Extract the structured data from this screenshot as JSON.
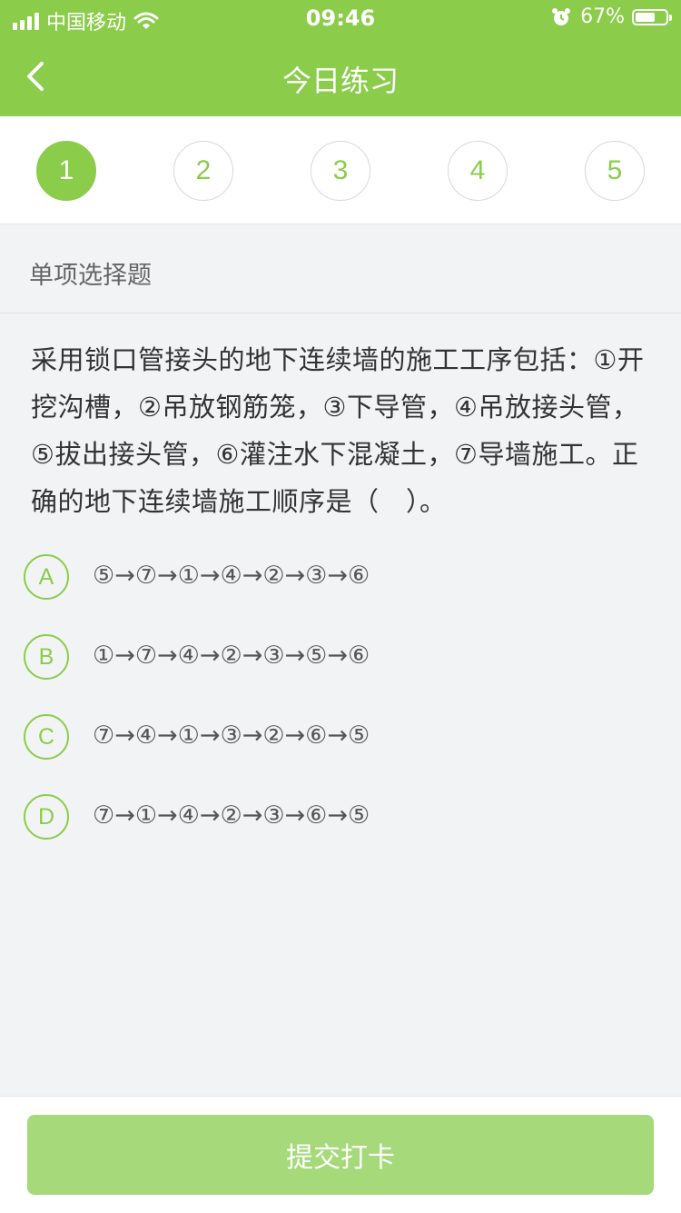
{
  "status_bar": {
    "carrier": "中国移动",
    "time": "09:46",
    "battery_percent": "67%",
    "battery_level": 0.67
  },
  "nav": {
    "title": "今日练习",
    "back_icon": "chevron-left-icon"
  },
  "steps": [
    {
      "label": "1",
      "active": true
    },
    {
      "label": "2",
      "active": false
    },
    {
      "label": "3",
      "active": false
    },
    {
      "label": "4",
      "active": false
    },
    {
      "label": "5",
      "active": false
    }
  ],
  "question": {
    "type": "单项选择题",
    "text": "采用锁口管接头的地下连续墙的施工工序包括：①开挖沟槽，②吊放钢筋笼，③下导管，④吊放接头管，⑤拔出接头管，⑥灌注水下混凝土，⑦导墙施工。正确的地下连续墙施工顺序是（　）。",
    "options": [
      {
        "letter": "A",
        "text": "⑤→⑦→①→④→②→③→⑥"
      },
      {
        "letter": "B",
        "text": "①→⑦→④→②→③→⑤→⑥"
      },
      {
        "letter": "C",
        "text": "⑦→④→①→③→②→⑥→⑤"
      },
      {
        "letter": "D",
        "text": "⑦→①→④→②→③→⑥→⑤"
      }
    ]
  },
  "footer": {
    "submit_label": "提交打卡"
  },
  "colors": {
    "accent": "#8bcc4b",
    "submit_disabled": "#a5d97a",
    "background": "#f2f3f5"
  }
}
